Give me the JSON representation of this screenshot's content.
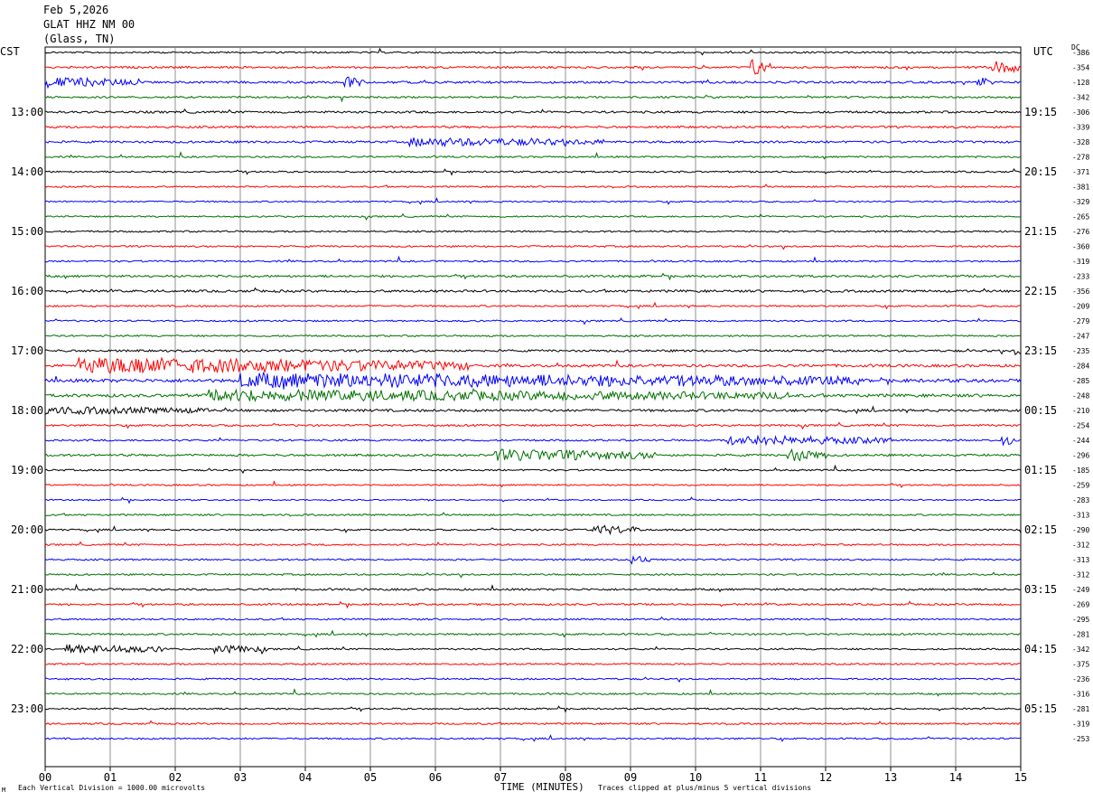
{
  "header": {
    "date": "Feb 5,2026",
    "station": "GLAT HHZ NM 00",
    "location": "(Glass, TN)"
  },
  "labels": {
    "left_tz": "CST",
    "right_tz": "UTC",
    "dc_header": "DC",
    "corner": "M"
  },
  "footer": {
    "scale": "Each Vertical Division = 1000.00 microvolts",
    "xlabel": "TIME (MINUTES)",
    "clip": "Traces clipped at plus/minus 5 vertical divisions"
  },
  "colors": {
    "trace_cycle": [
      "#000000",
      "#ff0000",
      "#0000ff",
      "#007000"
    ],
    "grid": "#777777"
  },
  "chart_data": {
    "type": "line",
    "title": "GLAT HHZ NM 00",
    "xlabel": "TIME (MINUTES)",
    "x_ticks": [
      "00",
      "01",
      "02",
      "03",
      "04",
      "05",
      "06",
      "07",
      "08",
      "09",
      "10",
      "11",
      "12",
      "13",
      "14",
      "15"
    ],
    "xlim": [
      0,
      15
    ],
    "left_hour_labels": [
      {
        "row": 4,
        "label": "13:00"
      },
      {
        "row": 8,
        "label": "14:00"
      },
      {
        "row": 12,
        "label": "15:00"
      },
      {
        "row": 16,
        "label": "16:00"
      },
      {
        "row": 20,
        "label": "17:00"
      },
      {
        "row": 24,
        "label": "18:00"
      },
      {
        "row": 28,
        "label": "19:00"
      },
      {
        "row": 32,
        "label": "20:00"
      },
      {
        "row": 36,
        "label": "21:00"
      },
      {
        "row": 40,
        "label": "22:00"
      },
      {
        "row": 44,
        "label": "23:00"
      }
    ],
    "right_hour_labels": [
      {
        "row": 4,
        "label": "19:15"
      },
      {
        "row": 8,
        "label": "20:15"
      },
      {
        "row": 12,
        "label": "21:15"
      },
      {
        "row": 16,
        "label": "22:15"
      },
      {
        "row": 20,
        "label": "23:15"
      },
      {
        "row": 24,
        "label": "00:15"
      },
      {
        "row": 28,
        "label": "01:15"
      },
      {
        "row": 32,
        "label": "02:15"
      },
      {
        "row": 36,
        "label": "03:15"
      },
      {
        "row": 40,
        "label": "04:15"
      },
      {
        "row": 44,
        "label": "05:15"
      }
    ],
    "dc_offsets": [
      "-386",
      "-354",
      "-128",
      "-342",
      "-306",
      "-339",
      "-328",
      "-278",
      "-371",
      "-381",
      "-329",
      "-265",
      "-276",
      "-360",
      "-319",
      "-233",
      "-356",
      "-209",
      "-279",
      "-247",
      "-235",
      "-284",
      "-285",
      "-248",
      "-210",
      "-254",
      "-244",
      "-296",
      "-185",
      "-259",
      "-283",
      "-313",
      "-290",
      "-312",
      "-313",
      "-312",
      "-249",
      "-269",
      "-295",
      "-281",
      "-342",
      "-375",
      "-236",
      "-316",
      "-281",
      "-319",
      "-253"
    ],
    "row_activity": [
      1.0,
      1.2,
      1.3,
      1.1,
      1.3,
      1.3,
      1.3,
      1.0,
      1.0,
      0.9,
      0.9,
      0.9,
      1.0,
      1.0,
      1.0,
      1.3,
      1.4,
      1.0,
      1.0,
      1.0,
      1.3,
      1.6,
      2.0,
      1.8,
      1.5,
      1.2,
      1.1,
      1.3,
      1.0,
      0.9,
      0.8,
      1.0,
      1.0,
      1.0,
      1.0,
      1.0,
      1.2,
      1.1,
      1.0,
      1.1,
      1.0,
      1.0,
      1.0,
      1.0,
      1.0,
      1.0,
      1.0
    ],
    "events": [
      {
        "row": 1,
        "minute": 10.85,
        "amp": 3.0,
        "dur": 0.3
      },
      {
        "row": 1,
        "minute": 14.5,
        "amp": 2.0,
        "dur": 0.6
      },
      {
        "row": 2,
        "minute": 0.0,
        "amp": 1.5,
        "dur": 1.4
      },
      {
        "row": 2,
        "minute": 4.6,
        "amp": 2.0,
        "dur": 0.3
      },
      {
        "row": 2,
        "minute": 14.3,
        "amp": 2.5,
        "dur": 0.2
      },
      {
        "row": 6,
        "minute": 5.6,
        "amp": 1.2,
        "dur": 3.0
      },
      {
        "row": 20,
        "minute": 14.9,
        "amp": 1.5,
        "dur": 0.2
      },
      {
        "row": 21,
        "minute": 0.5,
        "amp": 2.5,
        "dur": 6.0
      },
      {
        "row": 22,
        "minute": 3.0,
        "amp": 2.2,
        "dur": 9.5
      },
      {
        "row": 23,
        "minute": 2.5,
        "amp": 1.6,
        "dur": 9.0
      },
      {
        "row": 24,
        "minute": 0.0,
        "amp": 1.0,
        "dur": 2.5
      },
      {
        "row": 26,
        "minute": 10.5,
        "amp": 1.5,
        "dur": 2.5
      },
      {
        "row": 26,
        "minute": 14.7,
        "amp": 2.0,
        "dur": 0.2
      },
      {
        "row": 27,
        "minute": 6.9,
        "amp": 1.8,
        "dur": 2.5
      },
      {
        "row": 27,
        "minute": 11.4,
        "amp": 2.0,
        "dur": 0.6
      },
      {
        "row": 32,
        "minute": 8.4,
        "amp": 1.5,
        "dur": 0.8
      },
      {
        "row": 34,
        "minute": 9.0,
        "amp": 1.2,
        "dur": 0.3
      },
      {
        "row": 40,
        "minute": 0.3,
        "amp": 1.4,
        "dur": 1.6
      },
      {
        "row": 40,
        "minute": 2.6,
        "amp": 1.2,
        "dur": 0.8
      }
    ]
  }
}
